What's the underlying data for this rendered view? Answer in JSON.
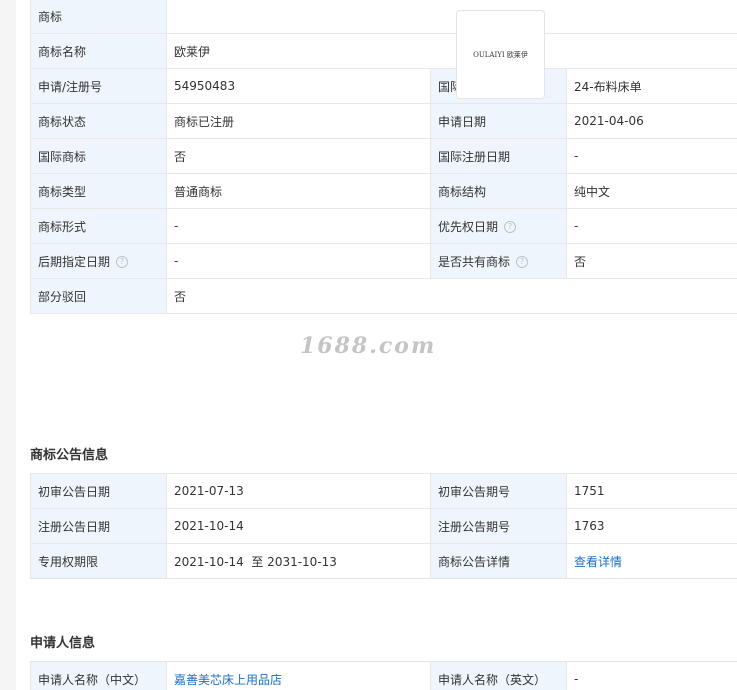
{
  "basic": {
    "logo_label": "商标",
    "logo_text": "OULAIYI 欧莱伊",
    "name_label": "商标名称",
    "name_value": "欧莱伊",
    "regno_label": "申请/注册号",
    "regno_value": "54950483",
    "intl_class_label": "国际分类",
    "intl_class_value": "24-布料床单",
    "status_label": "商标状态",
    "status_value": "商标已注册",
    "apply_date_label": "申请日期",
    "apply_date_value": "2021-04-06",
    "intl_mark_label": "国际商标",
    "intl_mark_value": "否",
    "intl_reg_date_label": "国际注册日期",
    "intl_reg_date_value": "-",
    "type_label": "商标类型",
    "type_value": "普通商标",
    "structure_label": "商标结构",
    "structure_value": "纯中文",
    "form_label": "商标形式",
    "form_value": "-",
    "priority_label": "优先权日期",
    "priority_value": "-",
    "later_label": "后期指定日期",
    "later_value": "-",
    "shared_label": "是否共有商标",
    "shared_value": "否",
    "partial_label": "部分驳回",
    "partial_value": "否"
  },
  "announce": {
    "title": "商标公告信息",
    "prelim_date_label": "初审公告日期",
    "prelim_date_value": "2021-07-13",
    "prelim_no_label": "初审公告期号",
    "prelim_no_value": "1751",
    "reg_date_label": "注册公告日期",
    "reg_date_value": "2021-10-14",
    "reg_no_label": "注册公告期号",
    "reg_no_value": "1763",
    "term_label": "专用权期限",
    "term_value": "2021-10-14  至 2031-10-13",
    "detail_label": "商标公告详情",
    "detail_link": "查看详情"
  },
  "applicant": {
    "title": "申请人信息",
    "name_cn_label": "申请人名称（中文）",
    "name_cn_value": "嘉善美芯床上用品店",
    "name_en_label": "申请人名称（英文）",
    "name_en_value": "-"
  },
  "watermark": "1688.com"
}
